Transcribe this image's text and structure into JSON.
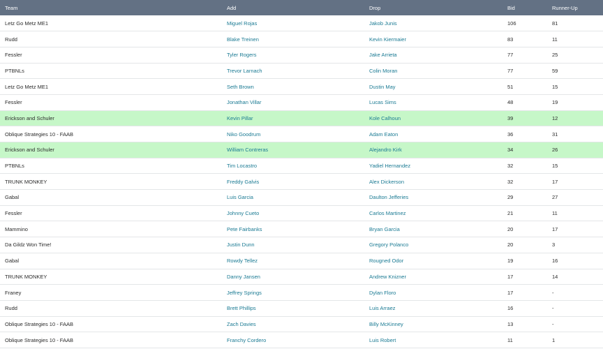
{
  "colors": {
    "header_bg": "#637184",
    "link": "#1a7a93",
    "highlight": "#c6f7c8"
  },
  "headers": [
    "Team",
    "Add",
    "Drop",
    "Bid",
    "Runner-Up"
  ],
  "rows": [
    {
      "team": "Letz Go Metz ME1",
      "add": "Miguel Rojas",
      "drop": "Jakob Junis",
      "bid": "106",
      "runner_up": "81",
      "highlight": false
    },
    {
      "team": "Rudd",
      "add": "Blake Treinen",
      "drop": "Kevin Kiermaier",
      "bid": "83",
      "runner_up": "11",
      "highlight": false
    },
    {
      "team": "Fessler",
      "add": "Tyler Rogers",
      "drop": "Jake Arrieta",
      "bid": "77",
      "runner_up": "25",
      "highlight": false
    },
    {
      "team": "PTBNLs",
      "add": "Trevor Larnach",
      "drop": "Colin Moran",
      "bid": "77",
      "runner_up": "59",
      "highlight": false
    },
    {
      "team": "Letz Go Metz ME1",
      "add": "Seth Brown",
      "drop": "Dustin May",
      "bid": "51",
      "runner_up": "15",
      "highlight": false
    },
    {
      "team": "Fessler",
      "add": "Jonathan Villar",
      "drop": "Lucas Sims",
      "bid": "48",
      "runner_up": "19",
      "highlight": false
    },
    {
      "team": "Erickson and Schuler",
      "add": "Kevin Pillar",
      "drop": "Kole Calhoun",
      "bid": "39",
      "runner_up": "12",
      "highlight": true
    },
    {
      "team": "Oblique Strategies 10 - FAAB",
      "add": "Niko Goodrum",
      "drop": "Adam Eaton",
      "bid": "36",
      "runner_up": "31",
      "highlight": false
    },
    {
      "team": "Erickson and Schuler",
      "add": "William Contreras",
      "drop": "Alejandro Kirk",
      "bid": "34",
      "runner_up": "26",
      "highlight": true
    },
    {
      "team": "PTBNLs",
      "add": "Tim Locastro",
      "drop": "Yadiel Hernandez",
      "bid": "32",
      "runner_up": "15",
      "highlight": false
    },
    {
      "team": "TRUNK MONKEY",
      "add": "Freddy Galvis",
      "drop": "Alex Dickerson",
      "bid": "32",
      "runner_up": "17",
      "highlight": false
    },
    {
      "team": "Gabal",
      "add": "Luis Garcia",
      "drop": "Daulton Jefferies",
      "bid": "29",
      "runner_up": "27",
      "highlight": false
    },
    {
      "team": "Fessler",
      "add": "Johnny Cueto",
      "drop": "Carlos Martinez",
      "bid": "21",
      "runner_up": "11",
      "highlight": false
    },
    {
      "team": "Mammino",
      "add": "Pete Fairbanks",
      "drop": "Bryan Garcia",
      "bid": "20",
      "runner_up": "17",
      "highlight": false
    },
    {
      "team": "Da Gildz Won Time!",
      "add": "Justin Dunn",
      "drop": "Gregory Polanco",
      "bid": "20",
      "runner_up": "3",
      "highlight": false
    },
    {
      "team": "Gabal",
      "add": "Rowdy Tellez",
      "drop": "Rougned Odor",
      "bid": "19",
      "runner_up": "16",
      "highlight": false
    },
    {
      "team": "TRUNK MONKEY",
      "add": "Danny Jansen",
      "drop": "Andrew Knizner",
      "bid": "17",
      "runner_up": "14",
      "highlight": false
    },
    {
      "team": "Franey",
      "add": "Jeffrey Springs",
      "drop": "Dylan Floro",
      "bid": "17",
      "runner_up": "-",
      "highlight": false
    },
    {
      "team": "Rudd",
      "add": "Brett Phillips",
      "drop": "Luis Arraez",
      "bid": "16",
      "runner_up": "-",
      "highlight": false
    },
    {
      "team": "Oblique Strategies 10 - FAAB",
      "add": "Zach Davies",
      "drop": "Billy McKinney",
      "bid": "13",
      "runner_up": "-",
      "highlight": false
    },
    {
      "team": "Oblique Strategies 10 - FAAB",
      "add": "Franchy Cordero",
      "drop": "Luis Robert",
      "bid": "11",
      "runner_up": "1",
      "highlight": false
    }
  ]
}
